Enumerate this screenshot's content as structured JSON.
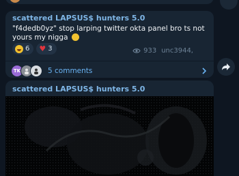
{
  "feed": {
    "posts": [
      {
        "sender": "scattered LAPSUS$ hunters 5.0",
        "text": "\"f4dedb0yz\" stop larping twitter okta panel bro  ts not yours my nigga",
        "reactions": [
          {
            "emoji": "laughing-face-icon",
            "count": "6"
          },
          {
            "emoji": "heart-icon",
            "count": "3"
          }
        ],
        "views": "933",
        "author_signature": "unc3944,",
        "comment_avatars": [
          {
            "initials": "TK"
          },
          {
            "initials": ""
          },
          {
            "initials": ""
          }
        ],
        "comments_label": "5 comments"
      },
      {
        "sender": "scattered LAPSUS$ hunters 5.0"
      }
    ]
  },
  "colors": {
    "background": "#0e1621",
    "bubble": "#182533",
    "sender_name": "#7fb6e6",
    "link": "#6ab3f3",
    "meta": "#6d8296"
  }
}
